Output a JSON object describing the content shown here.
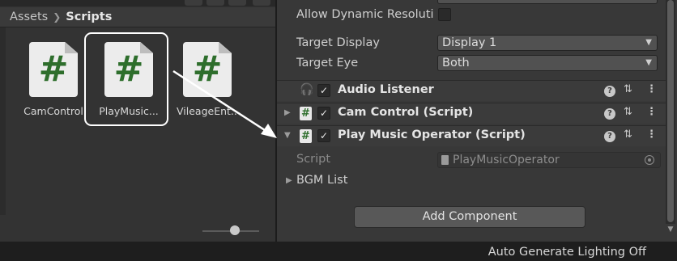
{
  "project_panel": {
    "breadcrumb": [
      "Assets",
      "Scripts"
    ],
    "assets": [
      {
        "label": "CamControl",
        "icon": "csharp-script-icon",
        "selected": false
      },
      {
        "label": "PlayMusic...",
        "icon": "csharp-script-icon",
        "selected": true
      },
      {
        "label": "VileageEnt...",
        "icon": "csharp-script-icon",
        "selected": false
      }
    ],
    "script_glyph": "#"
  },
  "inspector": {
    "camera_props": {
      "allow_dynamic_resolution_label": "Allow Dynamic Resoluti",
      "target_display_label": "Target Display",
      "target_display_value": "Display 1",
      "target_eye_label": "Target Eye",
      "target_eye_value": "Both"
    },
    "components": [
      {
        "title": "Audio Listener",
        "icon": "headphones-icon",
        "enabled": true,
        "expanded": null
      },
      {
        "title": "Cam Control (Script)",
        "icon": "csharp-script-icon",
        "enabled": true,
        "expanded": false
      },
      {
        "title": "Play Music Operator (Script)",
        "icon": "csharp-script-icon",
        "enabled": true,
        "expanded": true
      }
    ],
    "script_field": {
      "label": "Script",
      "value": "PlayMusicOperator"
    },
    "bgm_list_label": "BGM List",
    "add_component_label": "Add Component",
    "checkmark": "✓",
    "help_glyph": "?",
    "preset_glyph": "⇅",
    "menu_glyph": "⋮"
  },
  "status_bar": {
    "text": "Auto Generate Lighting Off"
  },
  "colors": {
    "panel_bg": "#383838",
    "project_bg": "#333333",
    "status_bg": "#1e1e1e",
    "script_green": "#2e6e2c",
    "audio_icon": "#e1a93a",
    "annotation": "#ffffff"
  }
}
